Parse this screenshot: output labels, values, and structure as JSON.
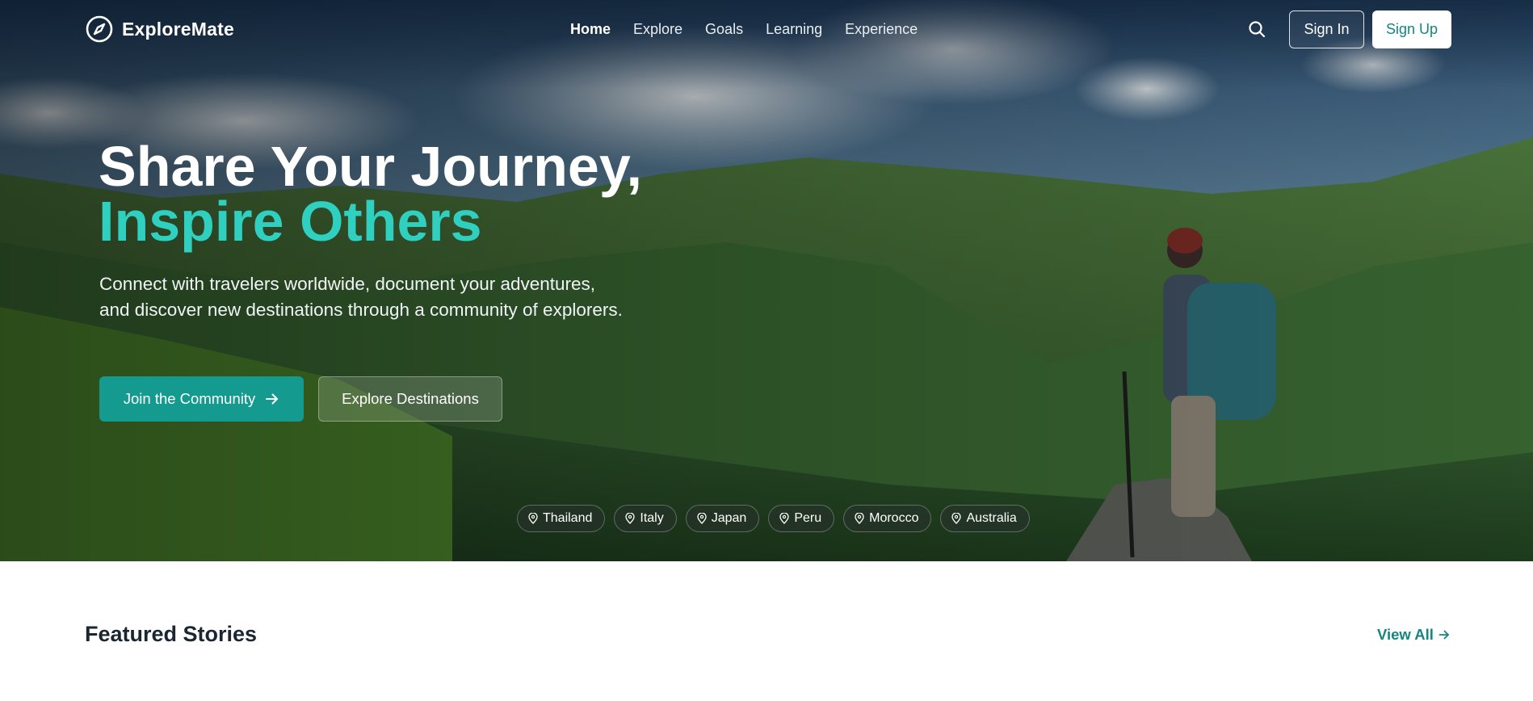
{
  "brand": {
    "name": "ExploreMate",
    "icon": "compass-icon"
  },
  "nav": {
    "items": [
      {
        "label": "Home",
        "active": true
      },
      {
        "label": "Explore",
        "active": false
      },
      {
        "label": "Goals",
        "active": false
      },
      {
        "label": "Learning",
        "active": false
      },
      {
        "label": "Experience",
        "active": false
      }
    ],
    "search_icon": "search-icon",
    "sign_in": "Sign In",
    "sign_up": "Sign Up"
  },
  "hero": {
    "title_line1": "Share Your Journey,",
    "title_line2": "Inspire Others",
    "subtitle": "Connect with travelers worldwide, document your adventures, and discover new destinations through a community of explorers.",
    "primary_button": "Join the Community",
    "secondary_button": "Explore Destinations",
    "destinations": [
      "Thailand",
      "Italy",
      "Japan",
      "Peru",
      "Morocco",
      "Australia"
    ]
  },
  "featured": {
    "title": "Featured Stories",
    "view_all": "View All"
  },
  "colors": {
    "accent": "#2fd0bf",
    "primary": "#149a8f",
    "link": "#14857f",
    "heading_dark": "#1b2633"
  }
}
